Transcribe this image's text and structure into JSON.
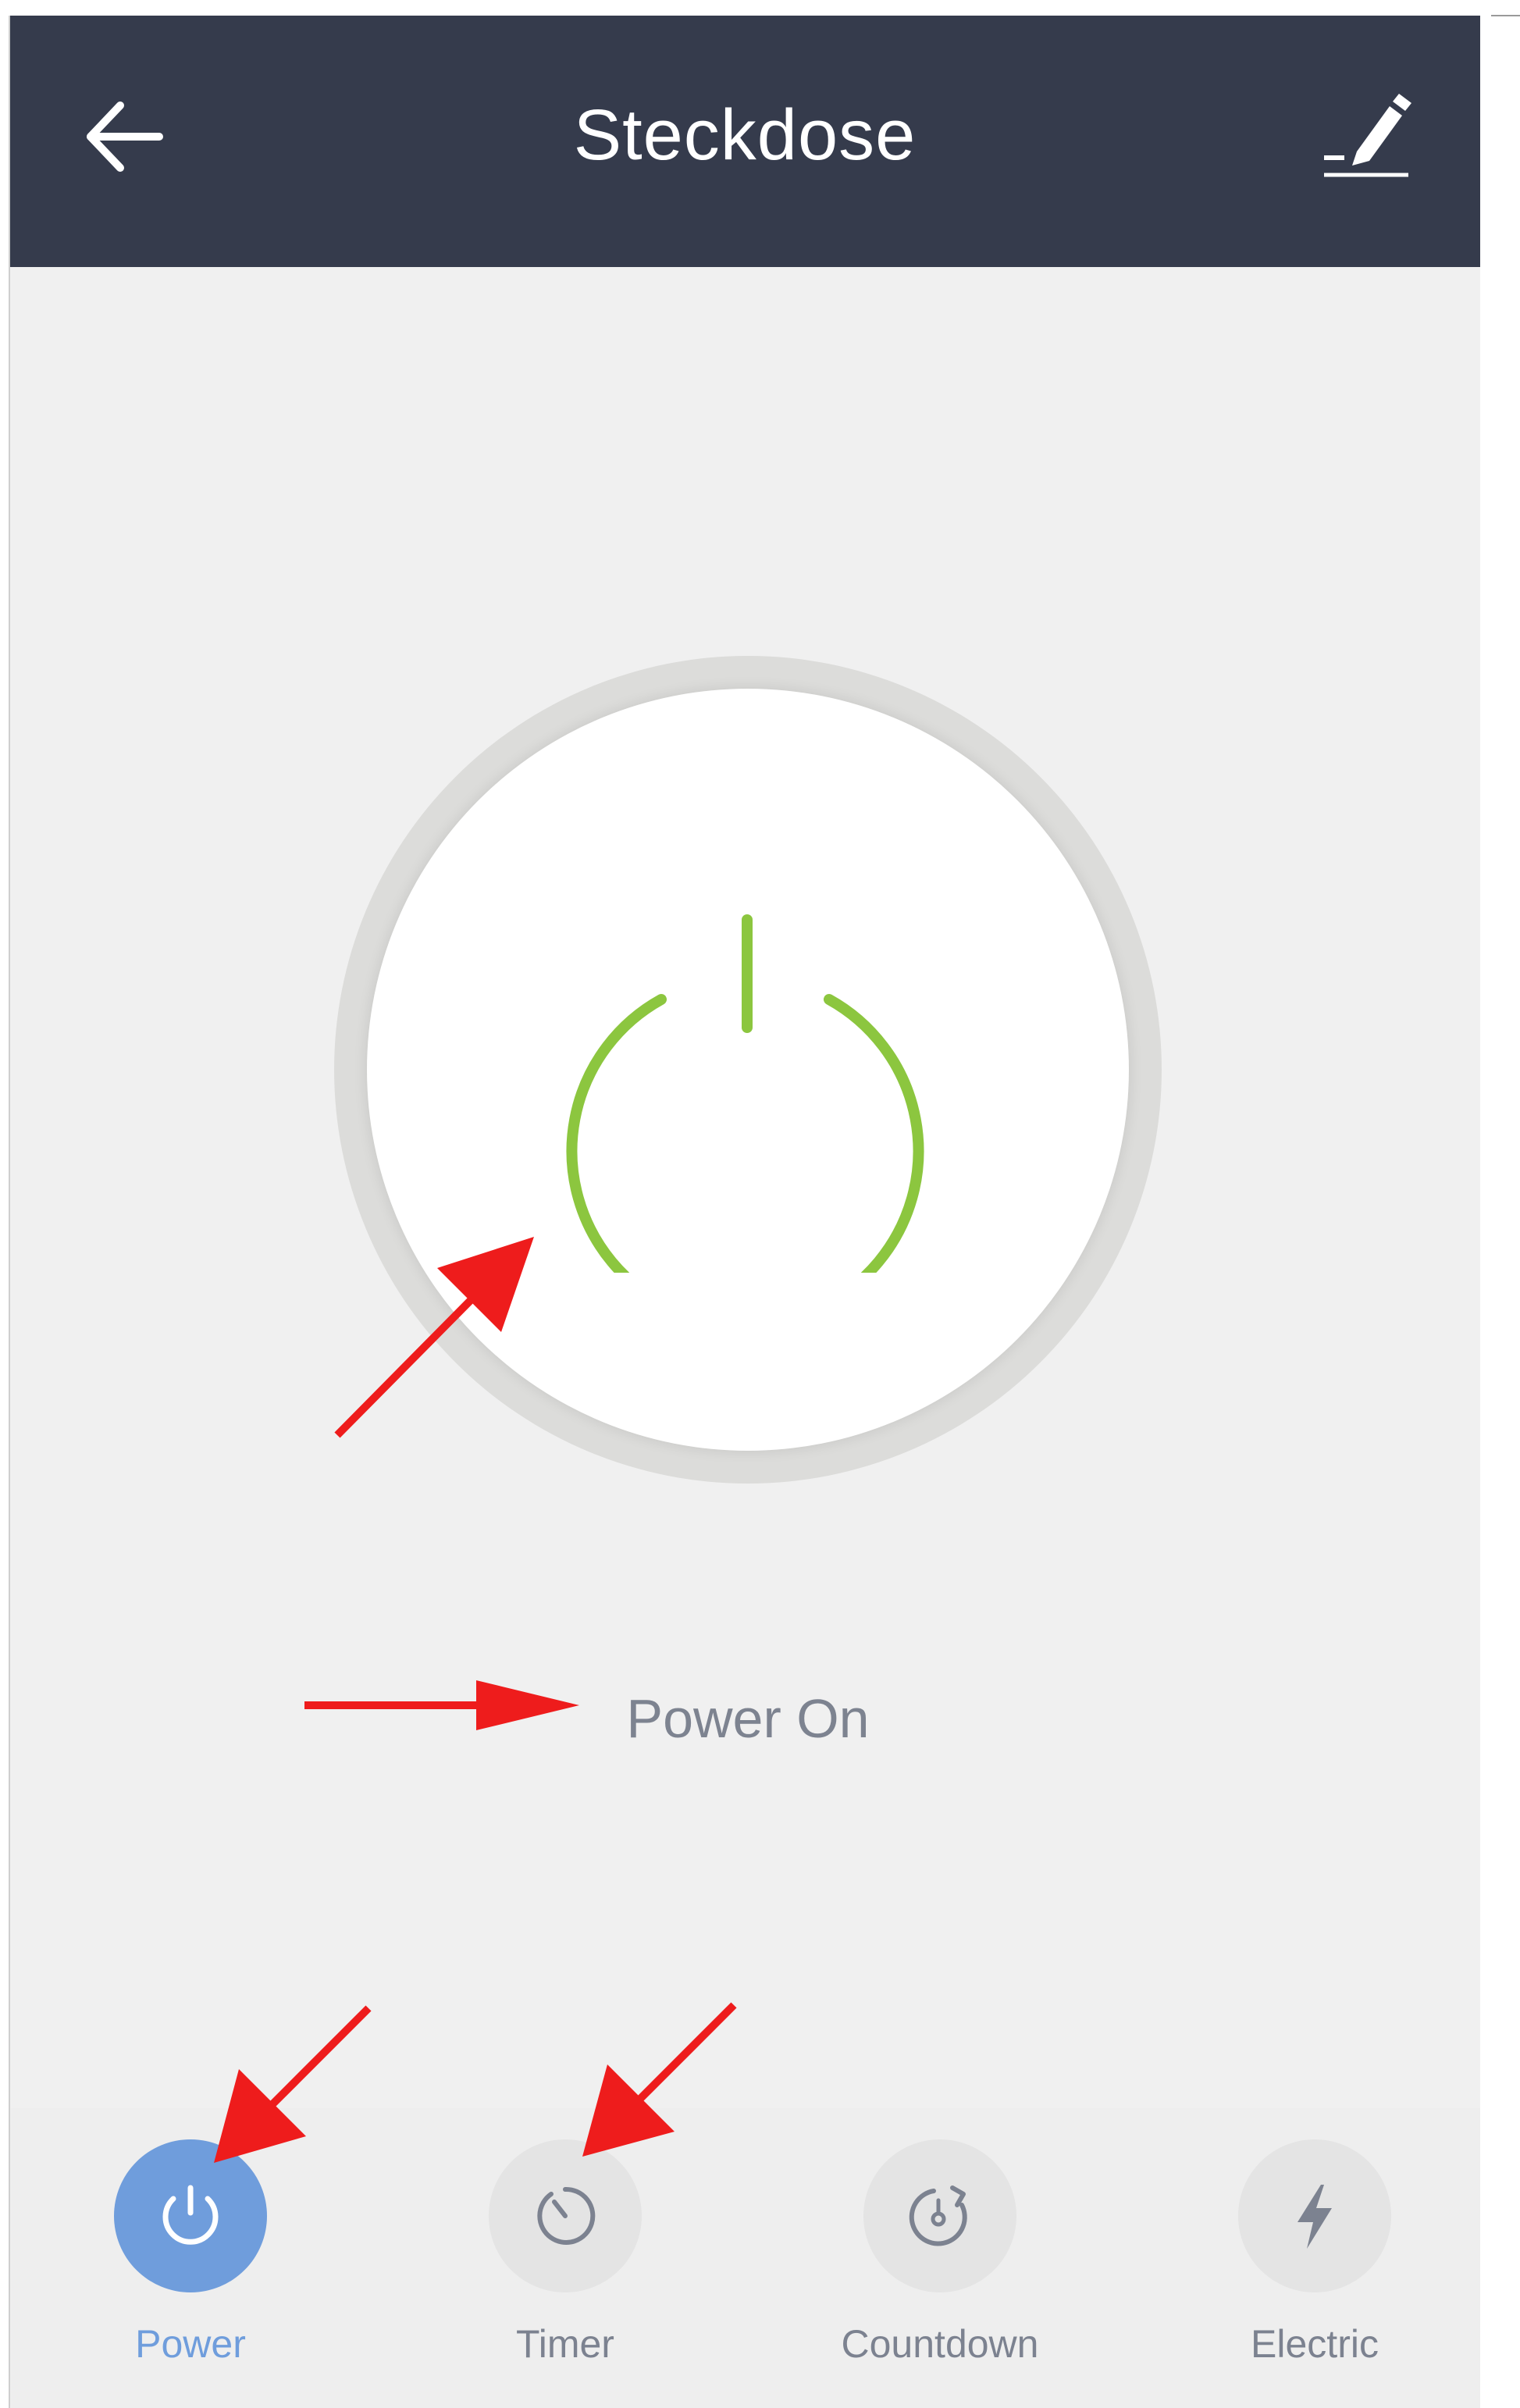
{
  "header": {
    "title": "Steckdose",
    "back_icon": "arrow-left-icon",
    "edit_icon": "pencil-edit-icon",
    "background_color": "#353b4c"
  },
  "main": {
    "power_icon": "power-icon",
    "power_icon_color": "#8cc63f",
    "status": "Power On"
  },
  "tabs": [
    {
      "label": "Power",
      "icon": "power-icon",
      "active": true
    },
    {
      "label": "Timer",
      "icon": "clock-icon",
      "active": false
    },
    {
      "label": "Countdown",
      "icon": "countdown-icon",
      "active": false
    },
    {
      "label": "Electric",
      "icon": "lightning-icon",
      "active": false
    }
  ],
  "colors": {
    "accent": "#6f9ddc",
    "annotation_arrow": "#ee1c1c"
  }
}
